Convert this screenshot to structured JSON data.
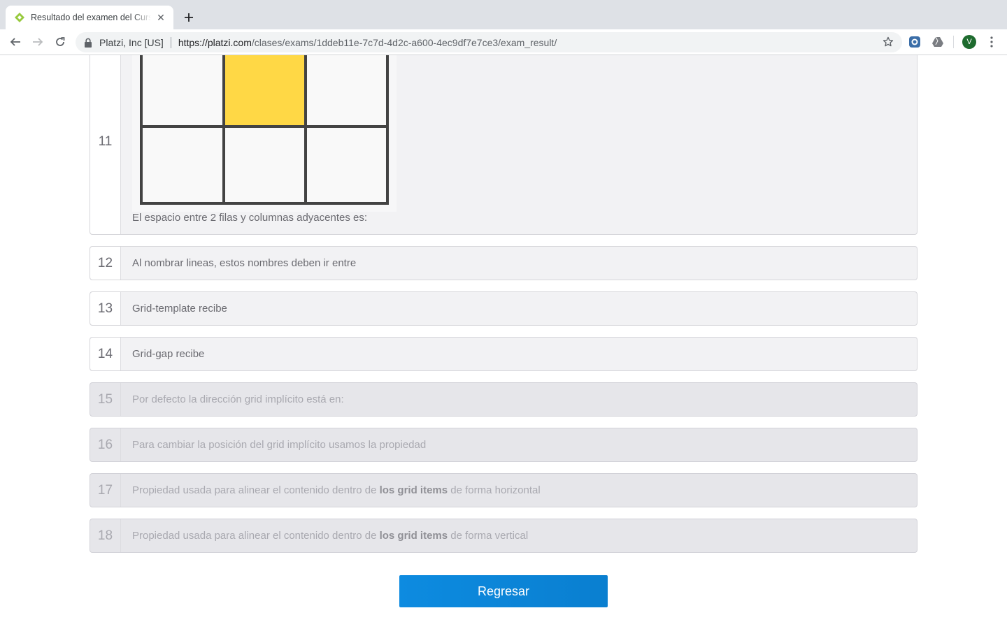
{
  "browser": {
    "tab": {
      "title": "Resultado del examen del Curso de CSS Grid Layout"
    },
    "omnibox": {
      "site_identity": "Platzi, Inc [US]",
      "url_host": "https://platzi.com",
      "url_path": "/clases/exams/1ddeb11e-7c7d-4d2c-a600-4ec9df7e7ce3/exam_result/"
    },
    "profile_initial": "V"
  },
  "colors": {
    "accent": "#0a84d6",
    "highlight_cell": "#ffd845",
    "favicon": "#98ca3f"
  },
  "questions": [
    {
      "number": "11",
      "text": "El espacio entre 2 filas y columnas adyacentes es:"
    },
    {
      "number": "12",
      "text": "Al nombrar lineas, estos nombres deben ir entre"
    },
    {
      "number": "13",
      "text": "Grid-template recibe"
    },
    {
      "number": "14",
      "text": "Grid-gap recibe"
    },
    {
      "number": "15",
      "text": "Por defecto la dirección grid implícito está en:"
    },
    {
      "number": "16",
      "text": "Para cambiar la posición del grid implícito usamos la propiedad"
    },
    {
      "number": "17",
      "text_before": "Propiedad usada para alinear el contenido dentro de ",
      "text_bold": "los grid items",
      "text_after": " de forma horizontal"
    },
    {
      "number": "18",
      "text_before": "Propiedad usada para alinear el contenido dentro de ",
      "text_bold": "los grid items",
      "text_after": " de forma vertical"
    }
  ],
  "actions": {
    "back_label": "Regresar"
  }
}
